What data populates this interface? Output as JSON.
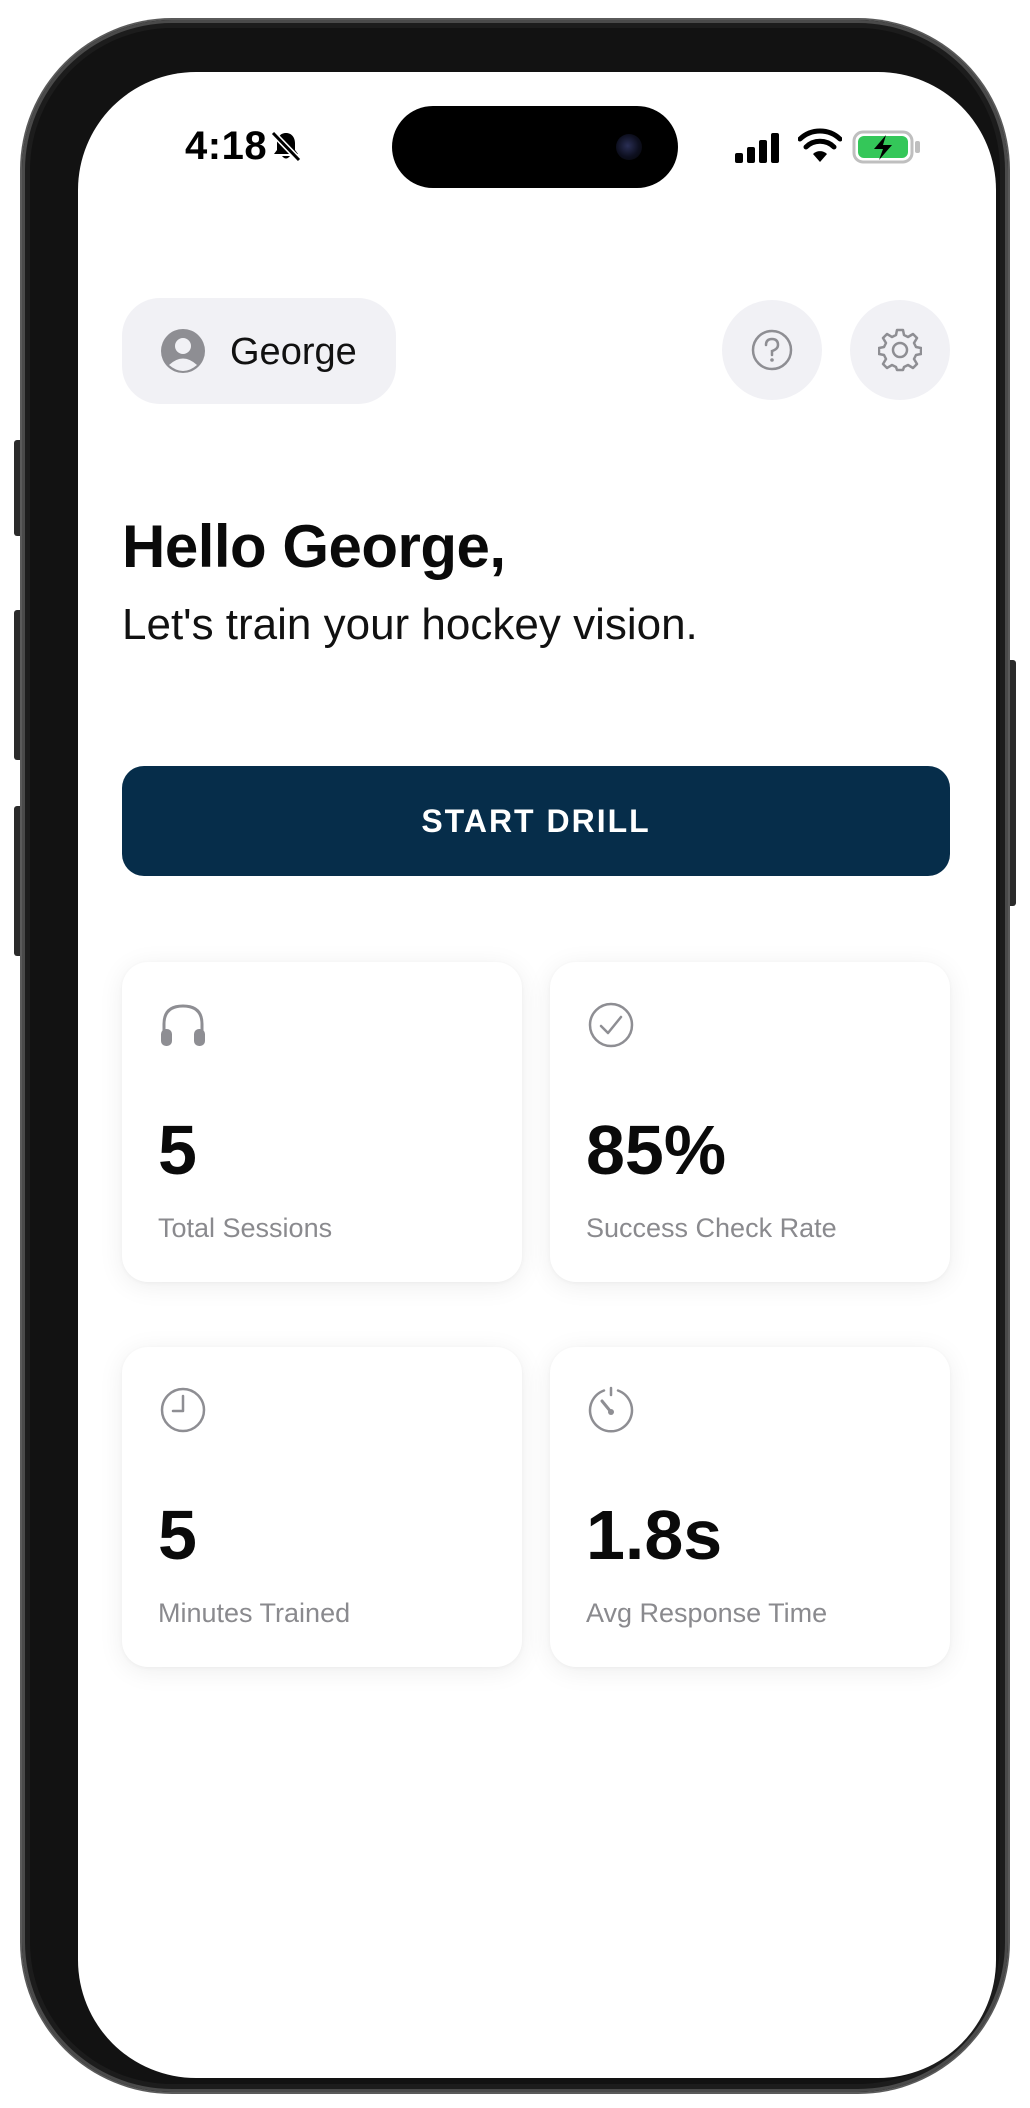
{
  "status_bar": {
    "time": "4:18",
    "icons": [
      "bell-slash-icon",
      "cellular-signal-icon",
      "wifi-icon",
      "battery-charging-icon"
    ],
    "battery_color": "#34c759"
  },
  "header": {
    "user_name": "George",
    "avatar_icon": "person-circle-icon",
    "help_icon": "question-circle-icon",
    "settings_icon": "gear-icon"
  },
  "greeting": {
    "title": "Hello George,",
    "subtitle": "Let's train your hockey vision."
  },
  "start_button": {
    "label": "START DRILL",
    "color": "#062d4a"
  },
  "stats": [
    {
      "icon": "headphones-icon",
      "value": "5",
      "label": "Total Sessions"
    },
    {
      "icon": "checkmark-circle-icon",
      "value": "85%",
      "label": "Success Check Rate"
    },
    {
      "icon": "clock-icon",
      "value": "5",
      "label": "Minutes Trained"
    },
    {
      "icon": "gauge-icon",
      "value": "1.8s",
      "label": "Avg Response Time"
    }
  ]
}
